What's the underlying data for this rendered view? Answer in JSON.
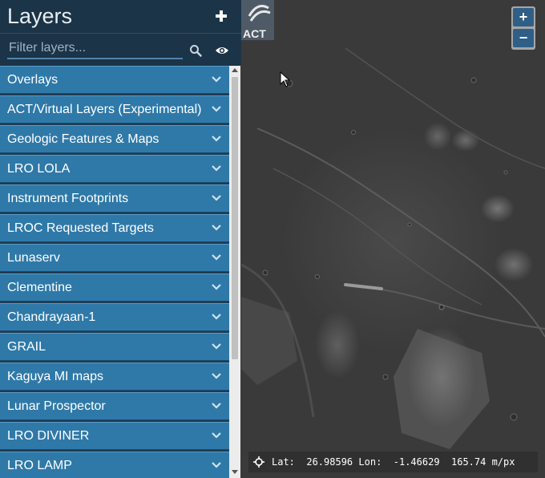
{
  "sidebar": {
    "title": "Layers",
    "add_icon": "plus-icon",
    "filter": {
      "placeholder": "Filter layers...",
      "value": ""
    },
    "search_icon": "search-icon",
    "visibility_icon": "eye-icon",
    "groups": [
      {
        "label": "Overlays"
      },
      {
        "label": "ACT/Virtual Layers (Experimental)"
      },
      {
        "label": "Geologic Features & Maps"
      },
      {
        "label": "LRO LOLA"
      },
      {
        "label": "Instrument Footprints"
      },
      {
        "label": "LROC Requested Targets"
      },
      {
        "label": "Lunaserv"
      },
      {
        "label": "Clementine"
      },
      {
        "label": "Chandrayaan-1"
      },
      {
        "label": "GRAIL"
      },
      {
        "label": "Kaguya MI maps"
      },
      {
        "label": "Lunar Prospector"
      },
      {
        "label": "LRO DIVINER"
      },
      {
        "label": "LRO LAMP"
      }
    ],
    "chevron_icon": "chevron-down-icon"
  },
  "map": {
    "logo_text": "ACT",
    "zoom": {
      "in_label": "+",
      "out_label": "−"
    },
    "coordinates": {
      "icon": "crosshair-icon",
      "lat_label": "Lat:",
      "lat": "26.98596",
      "lon_label": "Lon:",
      "lon": "-1.46629",
      "scale": "165.74 m/px"
    }
  },
  "colors": {
    "sidebar_bg": "#1c3447",
    "group_bg": "#2f79a9",
    "zoom_bg": "#2f5f86"
  }
}
